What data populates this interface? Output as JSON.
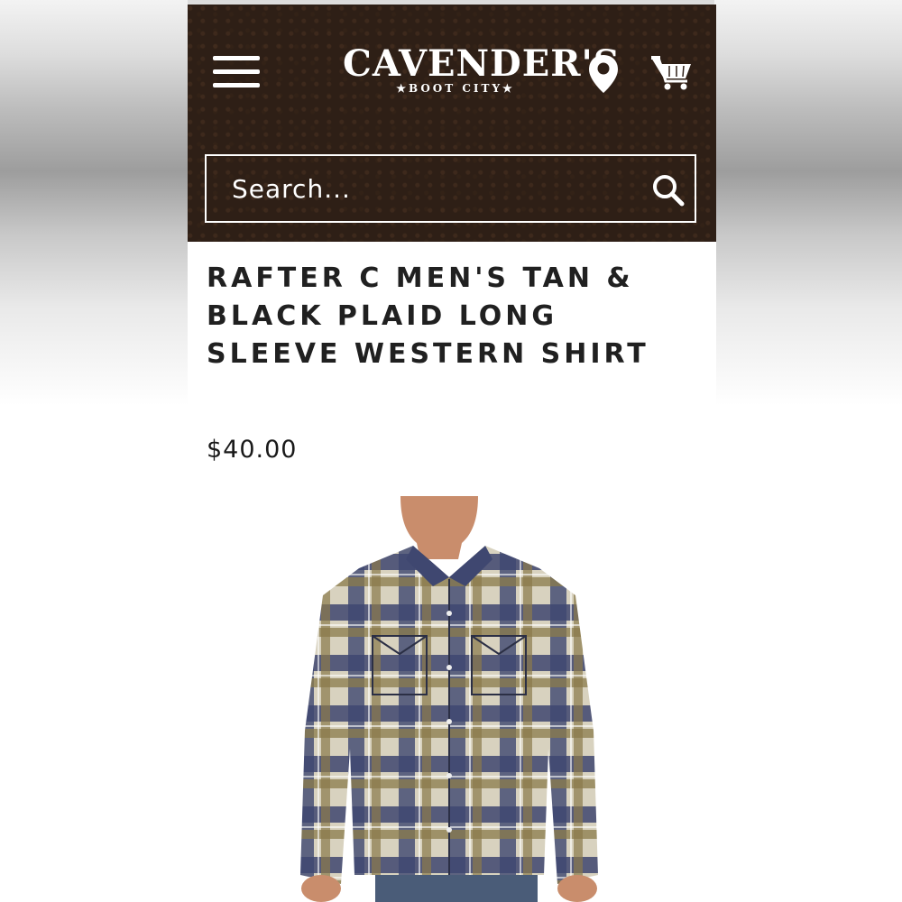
{
  "header": {
    "logo": {
      "brand": "CAVENDER'S",
      "tagline": "★BOOT CITY★"
    },
    "menu_icon": "hamburger-menu-icon",
    "location_icon": "location-pin-icon",
    "cart_icon": "shopping-cart-icon",
    "colors": {
      "background": "#2e1f16",
      "foreground": "#ffffff"
    }
  },
  "search": {
    "placeholder": "Search...",
    "icon": "search-icon"
  },
  "product": {
    "title": "RAFTER C MEN'S TAN & BLACK PLAID LONG SLEEVE WESTERN SHIRT",
    "price": "$40.00",
    "image_icon": "product-photo-plaid-shirt"
  }
}
